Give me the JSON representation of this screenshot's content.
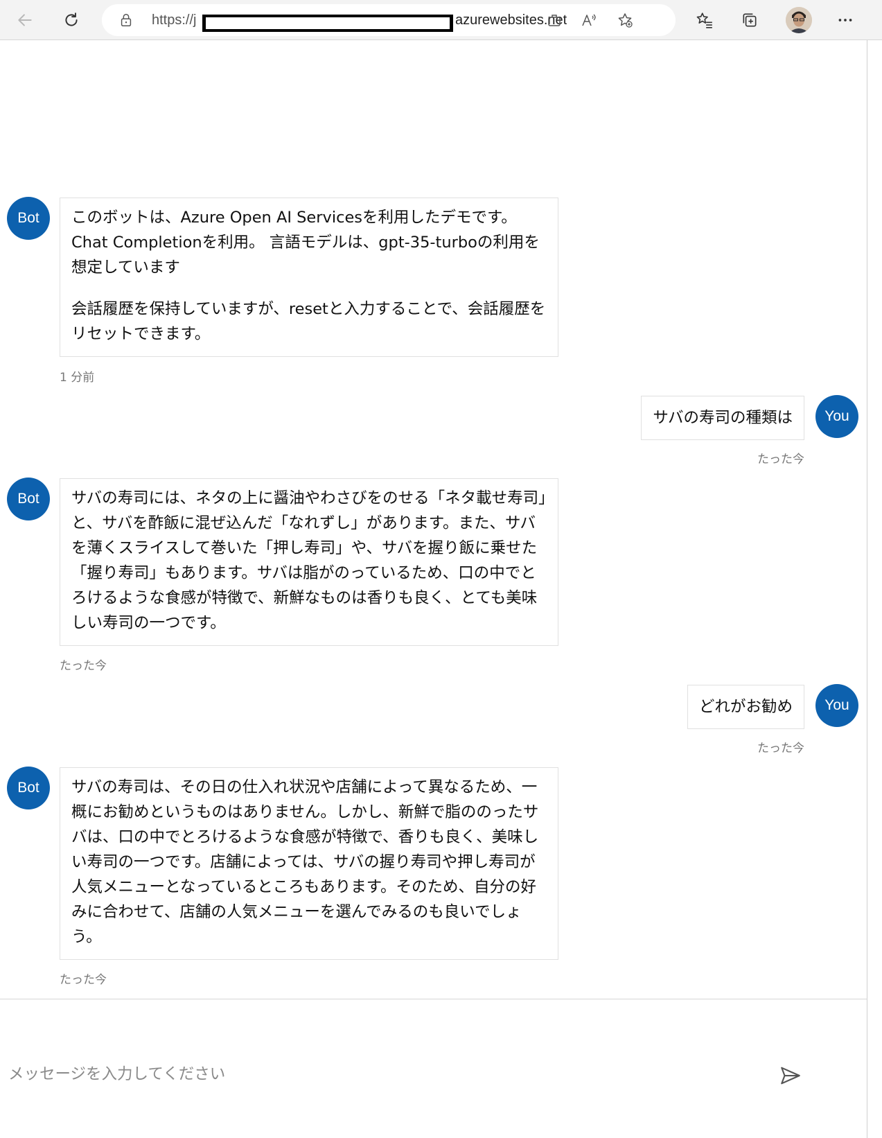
{
  "browser": {
    "url_prefix": "https://j",
    "url_suffix": "azurewebsites.net"
  },
  "messages": [
    {
      "sender": "Bot",
      "paragraphs": [
        "このボットは、Azure Open AI Servicesを利用したデモです。 Chat Completionを利用。 言語モデルは、gpt-35-turboの利用を想定しています",
        "会話履歴を保持していますが、resetと入力することで、会話履歴をリセットできます。"
      ],
      "timestamp": "1 分前"
    },
    {
      "sender": "You",
      "text": "サバの寿司の種類は",
      "timestamp": "たった今"
    },
    {
      "sender": "Bot",
      "paragraphs": [
        "サバの寿司には、ネタの上に醤油やわさびをのせる「ネタ載せ寿司」と、サバを酢飯に混ぜ込んだ「なれずし」があります。また、サバを薄くスライスして巻いた「押し寿司」や、サバを握り飯に乗せた「握り寿司」もあります。サバは脂がのっているため、口の中でとろけるような食感が特徴で、新鮮なものは香りも良く、とても美味しい寿司の一つです。"
      ],
      "timestamp": "たった今"
    },
    {
      "sender": "You",
      "text": "どれがお勧め",
      "timestamp": "たった今"
    },
    {
      "sender": "Bot",
      "paragraphs": [
        "サバの寿司は、その日の仕入れ状況や店舗によって異なるため、一概にお勧めというものはありません。しかし、新鮮で脂ののったサバは、口の中でとろけるような食感が特徴で、香りも良く、美味しい寿司の一つです。店舗によっては、サバの握り寿司や押し寿司が人気メニューとなっているところもあります。そのため、自分の好みに合わせて、店舗の人気メニューを選んでみるのも良いでしょう。"
      ],
      "timestamp": "たった今"
    }
  ],
  "composer": {
    "placeholder": "メッセージを入力してください"
  },
  "colors": {
    "avatar": "#0d61ae",
    "bubble_border": "#e0e0e0",
    "timestamp": "#777777"
  },
  "icons": [
    "back-arrow-icon",
    "refresh-icon",
    "lock-icon",
    "app-available-icon",
    "read-aloud-icon",
    "add-favorite-icon",
    "favorites-icon",
    "collections-icon",
    "profile-avatar",
    "more-icon",
    "send-icon"
  ]
}
